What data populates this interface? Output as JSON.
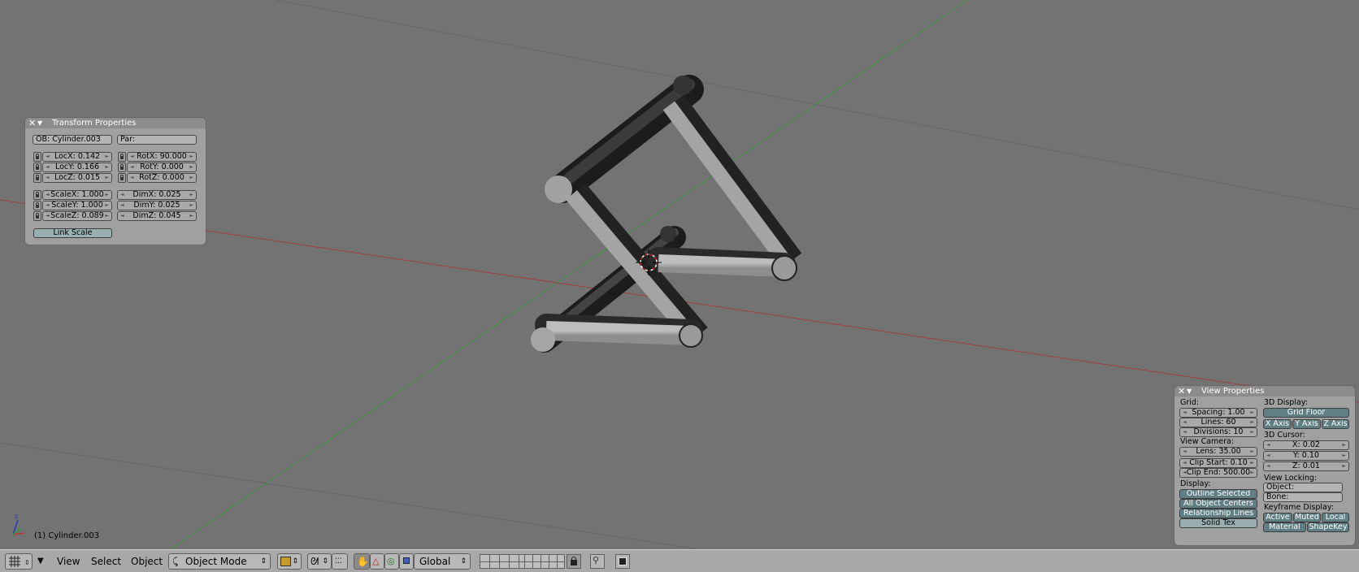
{
  "viewport": {
    "object_label": "(1) Cylinder.003",
    "axis_icon": "axis-gizmo-icon",
    "cursor_icon": "3d-cursor-icon"
  },
  "transform_panel": {
    "title": "Transform Properties",
    "ob_field": "OB: Cylinder.003",
    "par_field": "Par:",
    "loc": [
      "LocX: 0.142",
      "LocY: 0.166",
      "LocZ: 0.015"
    ],
    "rot": [
      "RotX: 90.000",
      "RotY: 0.000",
      "RotZ: 0.000"
    ],
    "scale": [
      "ScaleX: 1.000",
      "ScaleY: 1.000",
      "ScaleZ: 0.089"
    ],
    "dim": [
      "DimX: 0.025",
      "DimY: 0.025",
      "DimZ: 0.045"
    ],
    "link_scale": "Link Scale"
  },
  "view_panel": {
    "title": "View Properties",
    "grid_label": "Grid:",
    "spacing": "Spacing: 1.00",
    "lines": "Lines: 60",
    "divisions": "Divisions: 10",
    "view_camera_label": "View Camera:",
    "lens": "Lens: 35.00",
    "clip_start": "Clip Start: 0.10",
    "clip_end": "Clip End: 500.00",
    "display_label": "Display:",
    "outline_selected": "Outline Selected",
    "all_object_centers": "All Object Centers",
    "relationship_lines": "Relationship Lines",
    "solid_tex": "Solid Tex",
    "display3d_label": "3D Display:",
    "grid_floor": "Grid Floor",
    "x_axis": "X Axis",
    "y_axis": "Y Axis",
    "z_axis": "Z Axis",
    "cursor_label": "3D Cursor:",
    "cx": "X: 0.02",
    "cy": "Y: 0.10",
    "cz": "Z: 0.01",
    "view_locking_label": "View Locking:",
    "object_field": "Object:",
    "bone_field": "Bone:",
    "keyframe_label": "Keyframe Display:",
    "active": "Active",
    "muted": "Muted",
    "local": "Local",
    "material": "Material",
    "shapekey": "ShapeKey"
  },
  "header": {
    "menu_view": "View",
    "menu_select": "Select",
    "menu_object": "Object",
    "mode": "Object Mode",
    "orientation": "Global"
  },
  "colors": {
    "background": "#737373",
    "x_axis_line": "#a04040",
    "y_axis_line": "#3f8f3f",
    "panel": "#a4a4a4",
    "toggle_on": "#5f7f85"
  }
}
